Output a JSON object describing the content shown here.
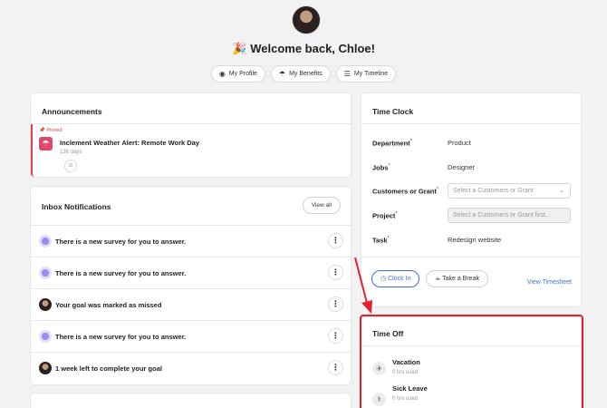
{
  "header": {
    "welcome_emoji": "🎉",
    "welcome": "Welcome back, Chloe!",
    "nav": [
      {
        "label": "My Profile",
        "icon": "user-circle-icon"
      },
      {
        "label": "My Benefits",
        "icon": "umbrella-icon"
      },
      {
        "label": "My Timeline",
        "icon": "list-icon"
      }
    ]
  },
  "announcements": {
    "title": "Announcements",
    "pinned_label": "Pinned",
    "item_title": "Inclement Weather Alert: Remote Work Day",
    "item_age": "136 days"
  },
  "inbox": {
    "title": "Inbox Notifications",
    "view_all": "View all",
    "items": [
      {
        "text": "There is a new survey for you to answer.",
        "icon": "survey-icon"
      },
      {
        "text": "There is a new survey for you to answer.",
        "icon": "survey-icon"
      },
      {
        "text": "Your goal was marked as missed",
        "icon": "avatar-icon"
      },
      {
        "text": "There is a new survey for you to answer.",
        "icon": "survey-icon"
      },
      {
        "text": "1 week left to complete your goal",
        "icon": "avatar-icon"
      }
    ]
  },
  "time_clock": {
    "title": "Time Clock",
    "department_label": "Department",
    "department_value": "Product",
    "jobs_label": "Jobs",
    "jobs_value": "Designer",
    "customers_label": "Customers or Grant",
    "customers_placeholder": "Select a Customers or Grant",
    "project_label": "Project",
    "project_placeholder": "Select a Customers or Grant first...",
    "task_label": "Task",
    "task_value": "Redesign website",
    "clock_in": "Clock In",
    "take_break": "Take a Break",
    "view_timesheet": "View Timesheet"
  },
  "time_off": {
    "title": "Time Off",
    "items": [
      {
        "name": "Vacation",
        "hours": "0 hrs used",
        "icon": "airplane-icon"
      },
      {
        "name": "Sick Leave",
        "hours": "0 hrs used",
        "icon": "stethoscope-icon"
      }
    ]
  },
  "colors": {
    "accent": "#3d6fd4",
    "highlight": "#e5202a",
    "pinned": "#e04050"
  }
}
